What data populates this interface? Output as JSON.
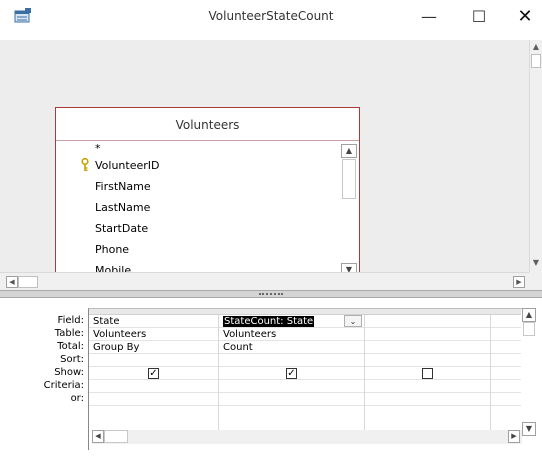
{
  "window": {
    "title": "VolunteerStateCount",
    "minimize_glyph": "—",
    "maximize_glyph": "☐",
    "close_glyph": "✕",
    "app_icon": "query-design-icon"
  },
  "table": {
    "title": "Volunteers",
    "fields": [
      "*",
      "VolunteerID",
      "FirstName",
      "LastName",
      "StartDate",
      "Phone",
      "Mobile"
    ],
    "primary_key_field": "VolunteerID"
  },
  "grid": {
    "row_labels": [
      "Field:",
      "Table:",
      "Total:",
      "Sort:",
      "Show:",
      "Criteria:",
      "or:"
    ],
    "columns": [
      {
        "field": "State",
        "table": "Volunteers",
        "total": "Group By",
        "sort": "",
        "show": true,
        "criteria": "",
        "or": ""
      },
      {
        "field": "StateCount: State",
        "table": "Volunteers",
        "total": "Count",
        "sort": "",
        "show": true,
        "criteria": "",
        "or": ""
      },
      {
        "field": "",
        "table": "",
        "total": "",
        "sort": "",
        "show": false,
        "criteria": "",
        "or": ""
      }
    ],
    "checked_glyph": "✓"
  },
  "colors": {
    "table_border": "#a83a3a",
    "upper_background": "#ededed",
    "key_icon": "#c9a000"
  }
}
